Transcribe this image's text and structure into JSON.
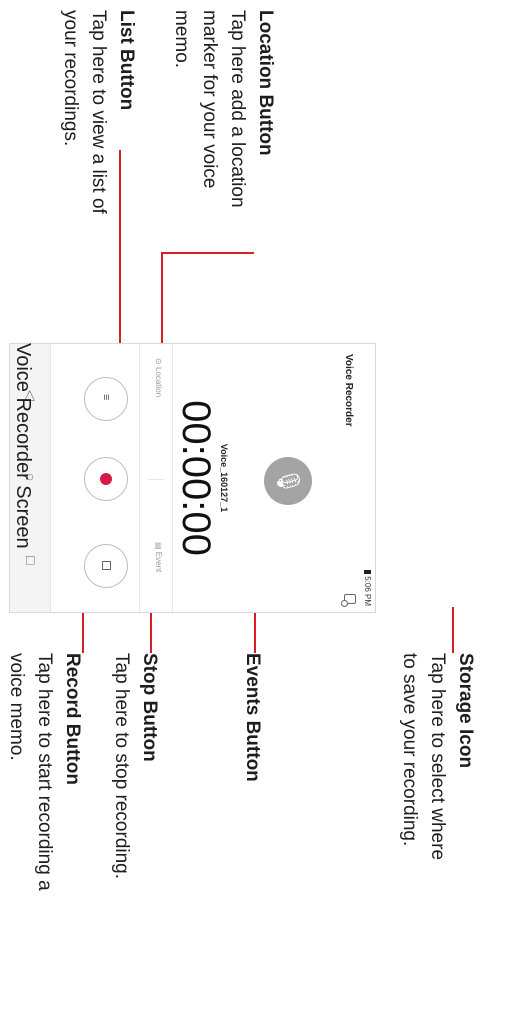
{
  "callouts": {
    "location": {
      "title": "Location Button",
      "body1": "Tap here add a location",
      "body2": "marker for your voice",
      "body3": "memo."
    },
    "list": {
      "title": "List Button",
      "body1": "Tap here to view a list of",
      "body2": "your recordings."
    },
    "storage": {
      "title": "Storage Icon",
      "body1": "Tap here to select where",
      "body2": "to save your recording."
    },
    "events": {
      "title": "Events Button"
    },
    "stop": {
      "title": "Stop Button",
      "body1": "Tap here to stop recording."
    },
    "record": {
      "title": "Record Button",
      "body1": "Tap here to start recording a",
      "body2": "voice memo."
    }
  },
  "phone": {
    "status_time": "5:06 PM",
    "app_title": "Voice Recorder",
    "filename": "Voice_160127_1",
    "timer": "00:00:00",
    "location_tag": "Location",
    "event_tag": "Event",
    "icons": [
      "storage-icon",
      "microphone-icon",
      "location-icon",
      "calendar-icon",
      "list-icon",
      "record-icon",
      "stop-icon",
      "back-icon",
      "home-icon",
      "recent-apps-icon"
    ]
  },
  "caption": "Voice Recorder Screen",
  "colors": {
    "callout_line": "#d81f26",
    "record_dot": "#d61a47",
    "mic_bg": "#a4a4a4"
  }
}
